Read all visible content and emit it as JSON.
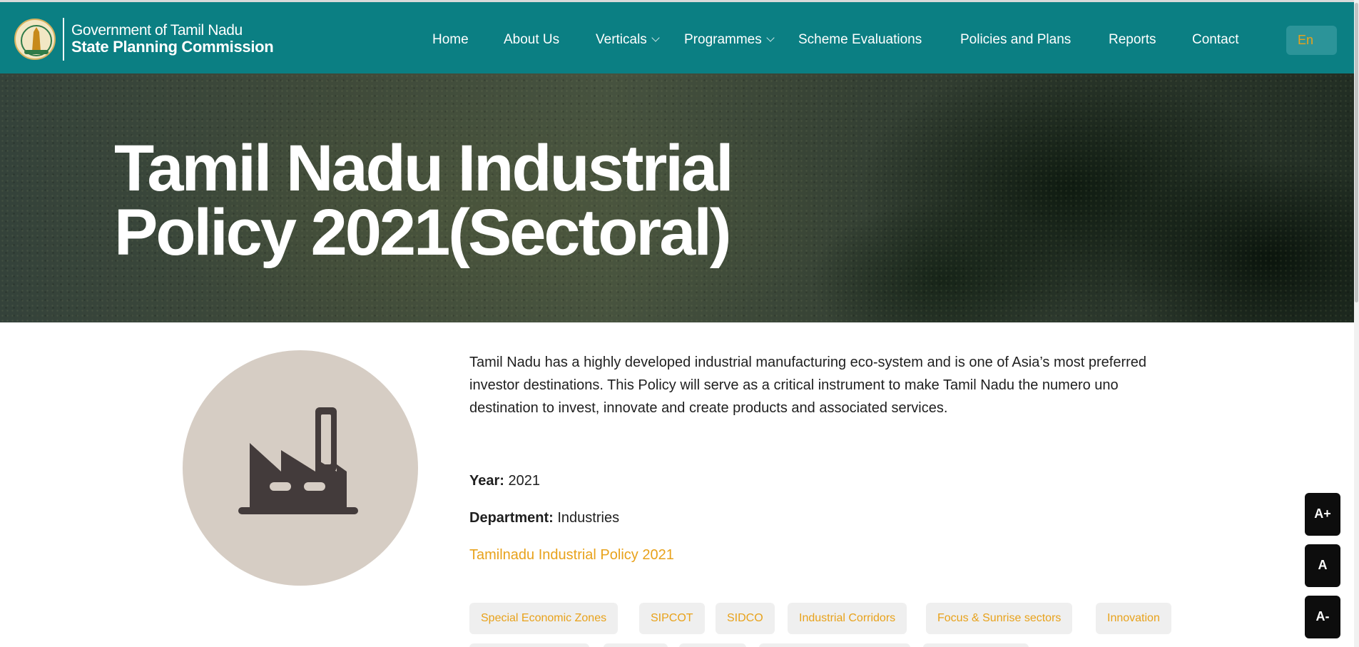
{
  "header": {
    "brand_line1": "Government of Tamil Nadu",
    "brand_line2": "State Planning Commission",
    "nav": [
      {
        "label": "Home"
      },
      {
        "label": "About Us"
      },
      {
        "label": "Verticals",
        "has_dropdown": true
      },
      {
        "label": "Programmes",
        "has_dropdown": true
      },
      {
        "label": "Scheme Evaluations"
      },
      {
        "label": "Policies and Plans"
      },
      {
        "label": "Reports"
      },
      {
        "label": "Contact"
      }
    ],
    "language": "En"
  },
  "hero": {
    "title_line1": "Tamil Nadu Industrial",
    "title_line2": "Policy 2021(Sectoral)"
  },
  "policy": {
    "icon": "factory-icon",
    "description": "Tamil Nadu has a highly developed industrial manufacturing eco-system and is one of Asia’s most preferred investor destinations.  This Policy will serve as a critical instrument to make Tamil Nadu the numero uno destination to invest, innovate and create products and associated services.",
    "year_label": "Year:",
    "year": "2021",
    "department_label": "Department:",
    "department": "Industries",
    "document_link": "Tamilnadu Industrial Policy 2021",
    "tags": [
      "Special Economic Zones",
      "SIPCOT",
      "SIDCO",
      "Industrial Corridors",
      "Focus & Sunrise sectors",
      "Innovation"
    ]
  },
  "font_controls": {
    "increase": "A+",
    "reset": "A",
    "decrease": "A-"
  },
  "colors": {
    "header_bg": "#0b7f83",
    "accent": "#e8a21b",
    "icon_circle": "#d6cdc4",
    "icon_fill": "#433b3b"
  }
}
